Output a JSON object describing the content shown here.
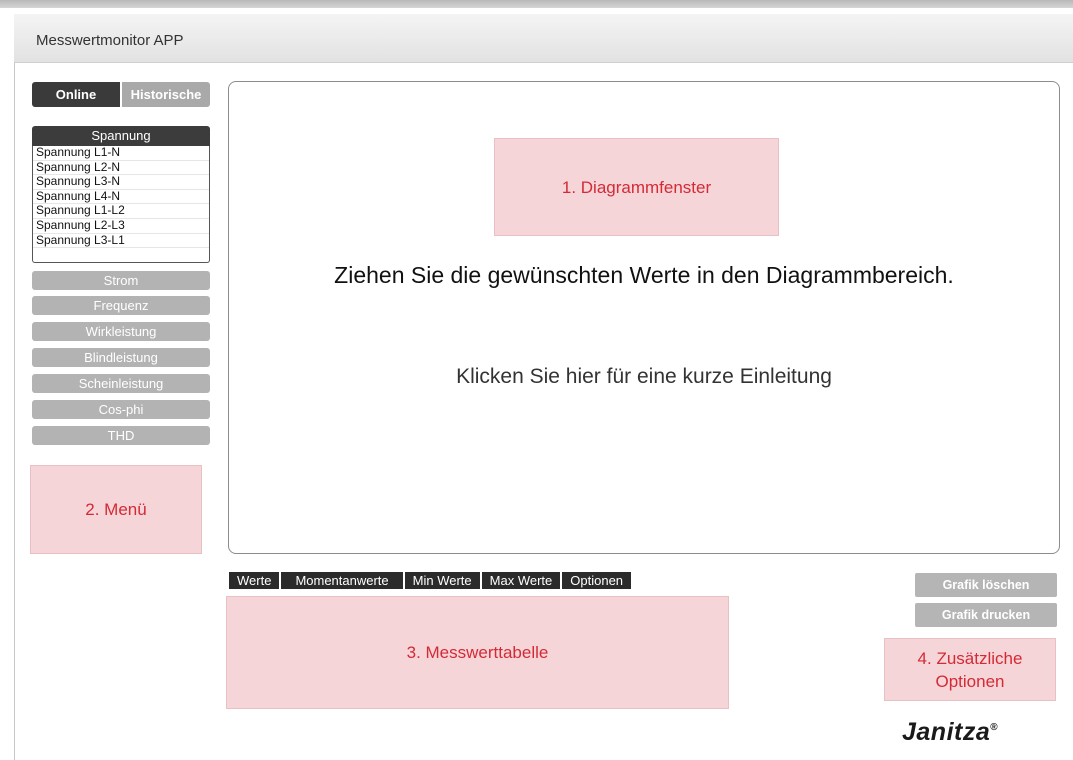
{
  "app": {
    "title": "Messwertmonitor APP"
  },
  "mode_toggle": {
    "online": "Online",
    "historical": "Historische"
  },
  "menu": {
    "open_category": {
      "label": "Spannung",
      "items": [
        "Spannung L1-N",
        "Spannung L2-N",
        "Spannung L3-N",
        "Spannung L4-N",
        "Spannung L1-L2",
        "Spannung L2-L3",
        "Spannung L3-L1"
      ]
    },
    "categories": [
      "Strom",
      "Frequenz",
      "Wirkleistung",
      "Blindleistung",
      "Scheinleistung",
      "Cos-phi",
      "THD"
    ]
  },
  "diagram": {
    "hint": "Ziehen Sie die gewünschten Werte in den Diagrammbereich.",
    "intro_link": "Klicken Sie hier für eine kurze Einleitung"
  },
  "table_tabs": [
    "Werte",
    "Momentanwerte",
    "Min Werte",
    "Max Werte",
    "Optionen"
  ],
  "actions": {
    "clear": "Grafik löschen",
    "print": "Grafik drucken"
  },
  "annotations": {
    "diagram": "1. Diagrammfenster",
    "menu": "2. Menü",
    "table": "3. Messwerttabelle",
    "options_line1": "4. Zusätzliche",
    "options_line2": "Optionen"
  },
  "brand": {
    "name": "Janitza",
    "mark": "®"
  },
  "colors": {
    "annotation_bg": "#f5d5d8",
    "annotation_text": "#d42a36",
    "active": "#3a3a3a",
    "inactive": "#b3b3b3"
  }
}
